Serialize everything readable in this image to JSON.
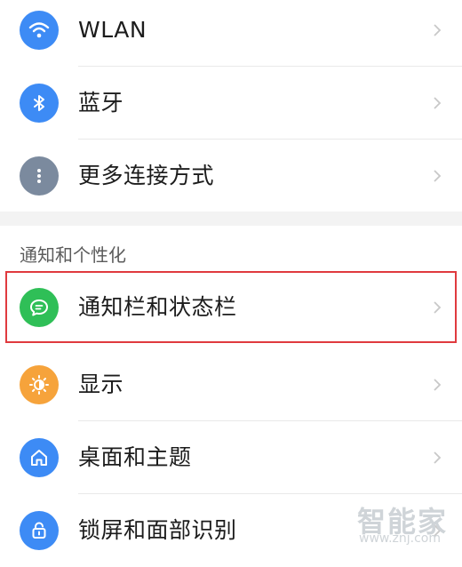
{
  "settings": {
    "connections": [
      {
        "label": "WLAN",
        "icon": "wifi-icon",
        "icon_color": "#3d8bf5"
      },
      {
        "label": "蓝牙",
        "icon": "bluetooth-icon",
        "icon_color": "#3d8bf5"
      },
      {
        "label": "更多连接方式",
        "icon": "more-dots-icon",
        "icon_color": "#7b8a9e"
      }
    ],
    "section_header": "通知和个性化",
    "personalization": [
      {
        "label": "通知栏和状态栏",
        "icon": "notification-bubble-icon",
        "icon_color": "#2fbf57",
        "highlighted": true
      },
      {
        "label": "显示",
        "icon": "brightness-icon",
        "icon_color": "#f6a33b"
      },
      {
        "label": "桌面和主题",
        "icon": "home-icon",
        "icon_color": "#3d8bf5"
      },
      {
        "label": "锁屏和面部识别",
        "icon": "lock-icon",
        "icon_color": "#3d8bf5"
      }
    ]
  },
  "highlight_color": "#e03a3e",
  "watermark": {
    "brand": "智能家",
    "url": "www.znj.com"
  }
}
